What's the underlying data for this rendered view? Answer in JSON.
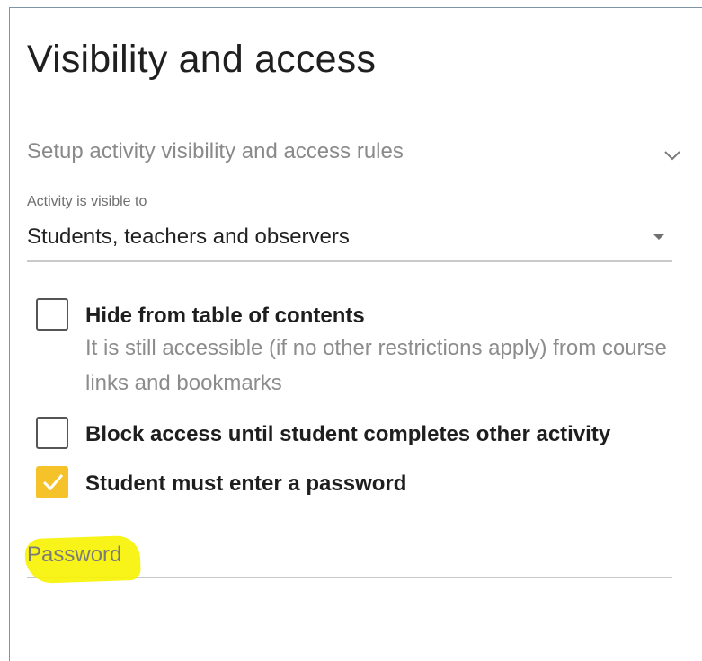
{
  "panel": {
    "title": "Visibility and access"
  },
  "section": {
    "label": "Setup activity visibility and access rules",
    "icon": "chevron-down-icon"
  },
  "visibility_select": {
    "label": "Activity is visible to",
    "value": "Students, teachers and observers"
  },
  "options": [
    {
      "label": "Hide from table of contents",
      "description": "It is still accessible (if no other restrictions apply) from course links and bookmarks",
      "checked": false
    },
    {
      "label": "Block access until student completes other activity",
      "checked": false
    },
    {
      "label": "Student must enter a password",
      "checked": true
    }
  ],
  "password_field": {
    "placeholder": "Password",
    "value": ""
  },
  "colors": {
    "accent": "#f6c229",
    "highlight": "#f7f200",
    "muted_text": "#8a8a8a"
  }
}
